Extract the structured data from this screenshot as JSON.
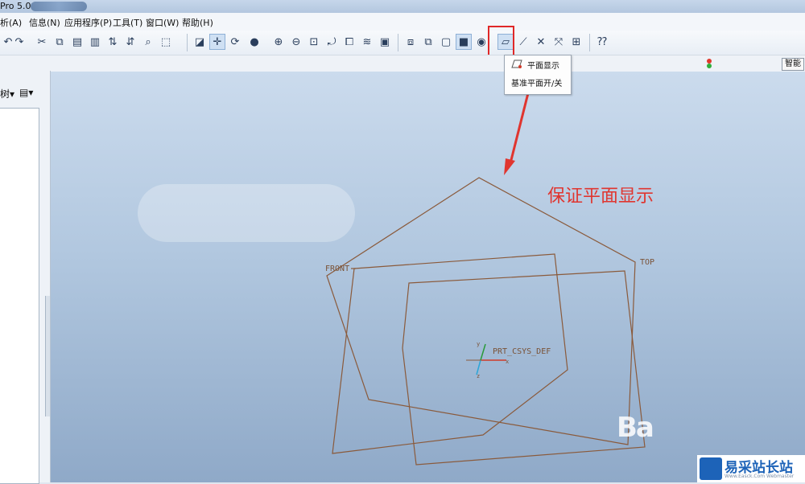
{
  "window": {
    "title": "Pro 5.0"
  },
  "menu": {
    "items": [
      {
        "label": "分析(A)",
        "visible": "析(A)"
      },
      {
        "label": "信息(N)"
      },
      {
        "label": "应用程序(P)"
      },
      {
        "label": "工具(T)"
      },
      {
        "label": "窗口(W)"
      },
      {
        "label": "帮助(H)"
      }
    ]
  },
  "toolbar": {
    "buttons": [
      "undo-icon",
      "redo-icon",
      "cut-icon",
      "copy-icon",
      "paste-icon",
      "paste-special-icon",
      "regenerate-icon",
      "regen-manager-icon",
      "find-icon",
      "select-box-icon",
      "repaint-icon",
      "spin-center-icon",
      "orient-mode-icon",
      "appearance-icon",
      "zoom-in-icon",
      "zoom-out-icon",
      "refit-icon",
      "reorient-icon",
      "saved-views-icon",
      "layers-icon",
      "view-manager-icon",
      "wireframe-icon",
      "hidden-line-icon",
      "no-hidden-icon",
      "shading-icon",
      "enhanced-realism-icon",
      "datum-plane-display-icon",
      "datum-axis-display-icon",
      "datum-point-display-icon",
      "csys-display-icon",
      "annotation-display-icon",
      "context-help-icon"
    ]
  },
  "status": {
    "smart_filter": "智能"
  },
  "sidebar": {
    "tab_model": "树▾",
    "tab_settings": "▤▾"
  },
  "tooltip": {
    "title": "平面显示",
    "description": "基准平面开/关"
  },
  "annotation": {
    "text": "保证平面显示"
  },
  "datum": {
    "front": "FRONT",
    "top": "TOP",
    "csys": "PRT_CSYS_DEF",
    "axis_x": "x",
    "axis_y": "y",
    "axis_z": "z"
  },
  "watermark": {
    "bai": "Ba",
    "brand": "易采站长站",
    "brand_sub": "Www.Easck.Com  Webmaster"
  },
  "colors": {
    "datum_line": "#8a5a3b",
    "annotation_red": "#e0352f",
    "highlight_red": "#e02828",
    "brand_blue": "#1d63b8"
  }
}
